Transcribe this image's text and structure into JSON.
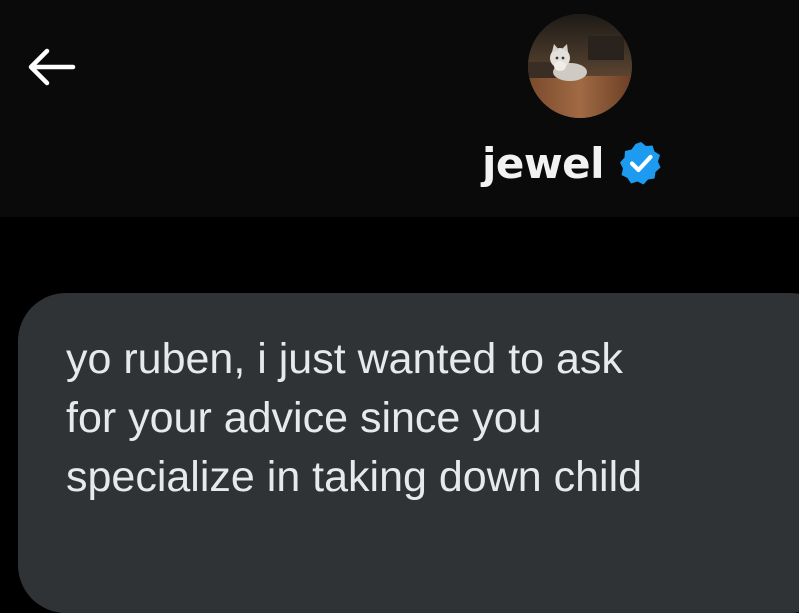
{
  "header": {
    "back_icon": "arrow-left-icon",
    "avatar_icon": "cat-photo-avatar",
    "contact_name": "jewel",
    "verified_icon": "verified-badge-icon",
    "badge_color": "#1d9bf0"
  },
  "message": {
    "text": "yo ruben, i just wanted to ask\nfor your advice since you\nspecialize in taking down child",
    "bubble_color": "#2f3336"
  }
}
